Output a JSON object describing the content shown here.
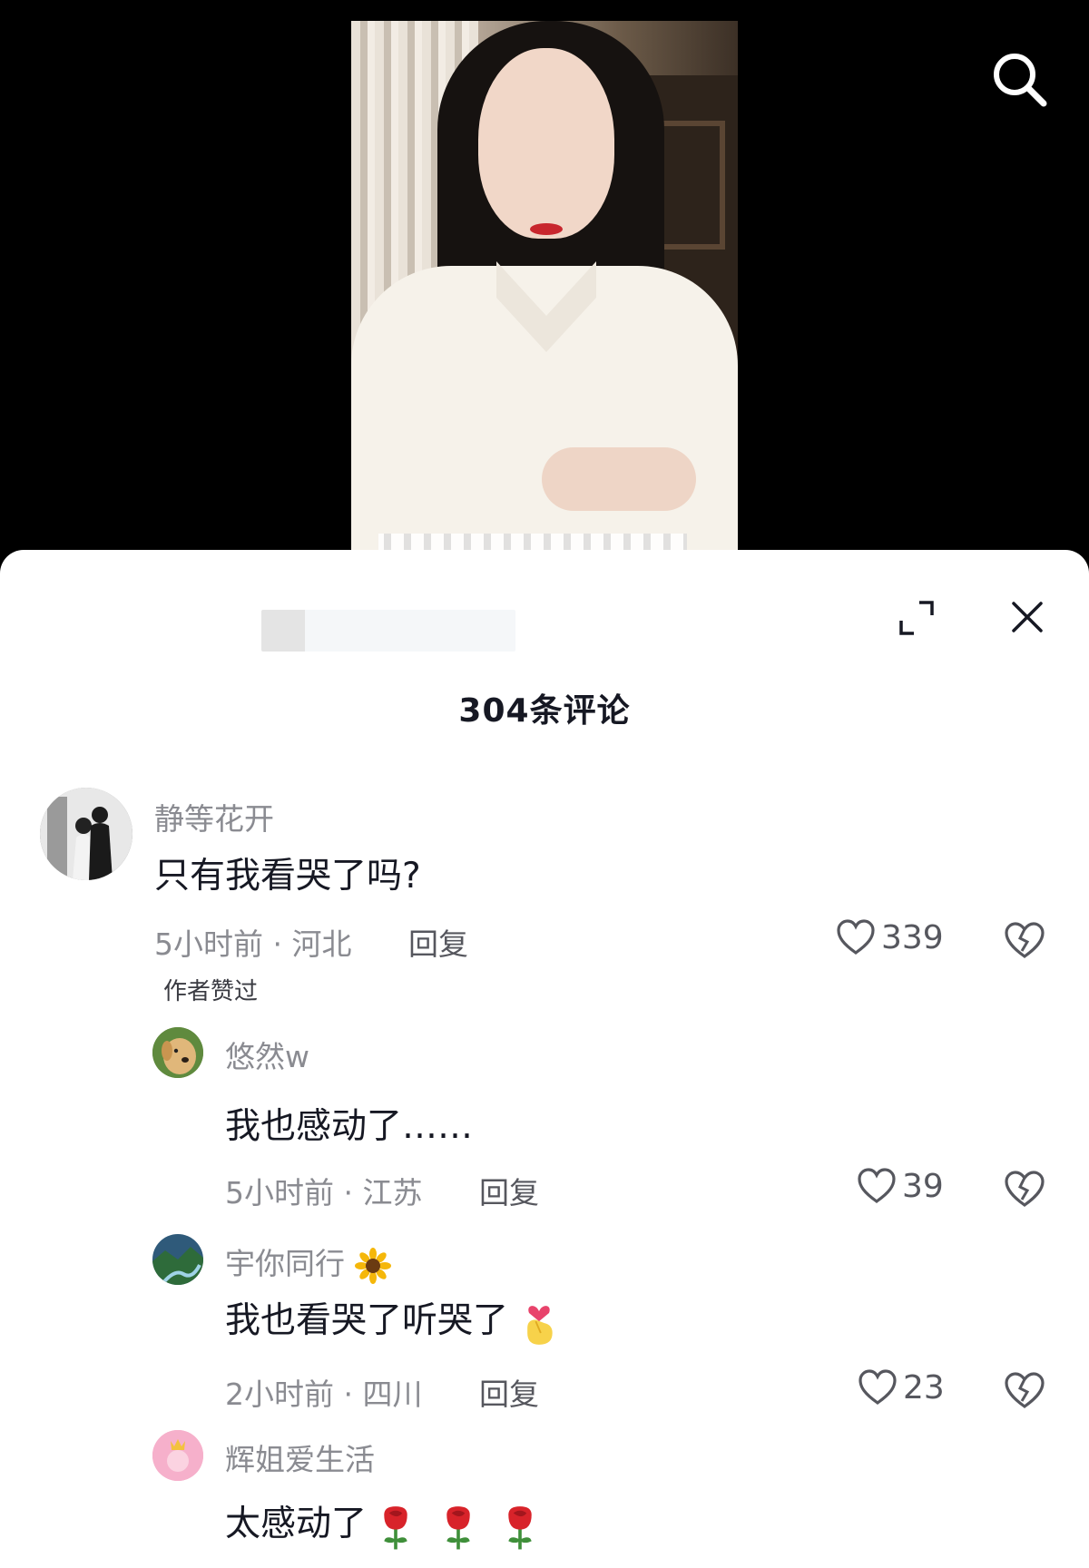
{
  "icons": {
    "search": "search-icon",
    "expand": "expand-icon",
    "close": "close-icon",
    "like": "heart-icon",
    "dislike": "broken-heart-icon"
  },
  "colors": {
    "sheet_bg": "#ffffff",
    "text_primary": "#161823",
    "text_secondary": "#8a8b91",
    "rose": "#d8232a"
  },
  "sheet": {
    "title": "304条评论"
  },
  "comments": [
    {
      "user": "静等花开",
      "text": "只有我看哭了吗?",
      "meta": "5小时前 · 河北",
      "reply_label": "回复",
      "likes": "339",
      "badge": "作者赞过"
    },
    {
      "user": "悠然w",
      "text": "我也感动了……",
      "meta": "5小时前 · 江苏",
      "reply_label": "回复",
      "likes": "39"
    },
    {
      "user": "宇你同行",
      "user_emoji": "sunflower",
      "text": "我也看哭了听哭了",
      "text_emoji": "finger-heart",
      "meta": "2小时前 · 四川",
      "reply_label": "回复",
      "likes": "23"
    },
    {
      "user": "辉姐爱生活",
      "text": "太感动了",
      "text_emoji": "rose x3"
    }
  ]
}
